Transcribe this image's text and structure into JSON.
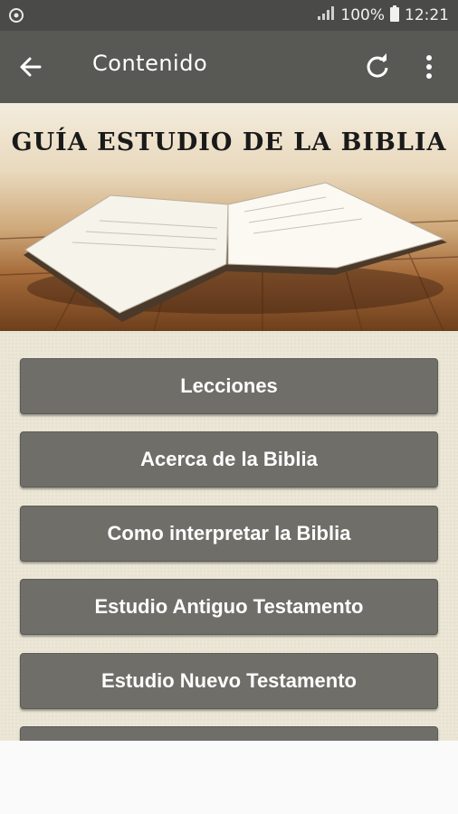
{
  "status_bar": {
    "battery": "100%",
    "time": "12:21",
    "icons": [
      "sync-icon",
      "signal-icon",
      "battery-icon"
    ]
  },
  "app_bar": {
    "title": "Contenido",
    "icons": [
      "back-arrow-icon",
      "refresh-icon",
      "more-vert-icon"
    ]
  },
  "banner": {
    "title": "GUÍA ESTUDIO DE LA BIBLIA"
  },
  "menu": {
    "items": [
      {
        "label": "Lecciones"
      },
      {
        "label": "Acerca de la Biblia"
      },
      {
        "label": "Como interpretar la Biblia"
      },
      {
        "label": "Estudio Antiguo Testamento"
      },
      {
        "label": "Estudio Nuevo Testamento"
      },
      {
        "label": ""
      }
    ]
  },
  "colors": {
    "app_bar": "#585855",
    "status_bar": "#4a4a48",
    "button": "#6f6e69",
    "content_bg": "#ebe6d6"
  }
}
